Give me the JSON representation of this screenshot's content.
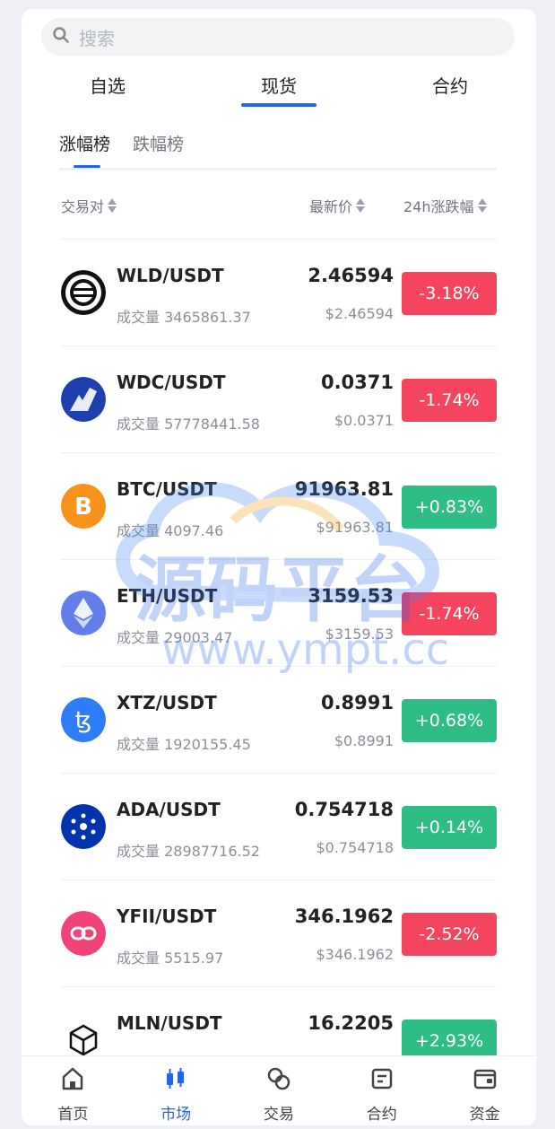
{
  "search": {
    "placeholder": "搜索"
  },
  "tabs": [
    {
      "label": "自选"
    },
    {
      "label": "现货"
    },
    {
      "label": "合约"
    }
  ],
  "subtabs": [
    {
      "label": "涨幅榜"
    },
    {
      "label": "跌幅榜"
    }
  ],
  "columns": {
    "pair": "交易对",
    "price": "最新价",
    "change": "24h涨跌幅"
  },
  "volume_prefix": "成交量",
  "rows": [
    {
      "pair": "WLD/USDT",
      "price": "2.46594",
      "volume": "成交量 3465861.37",
      "usd": "$2.46594",
      "change": "-3.18%",
      "dir": "down",
      "icon": "wld-coin-icon"
    },
    {
      "pair": "WDC/USDT",
      "price": "0.0371",
      "volume": "成交量 57778441.58",
      "usd": "$0.0371",
      "change": "-1.74%",
      "dir": "down",
      "icon": "wdc-coin-icon"
    },
    {
      "pair": "BTC/USDT",
      "price": "91963.81",
      "volume": "成交量 4097.46",
      "usd": "$91963.81",
      "change": "+0.83%",
      "dir": "up",
      "icon": "btc-coin-icon"
    },
    {
      "pair": "ETH/USDT",
      "price": "3159.53",
      "volume": "成交量 29003.47",
      "usd": "$3159.53",
      "change": "-1.74%",
      "dir": "down",
      "icon": "eth-coin-icon"
    },
    {
      "pair": "XTZ/USDT",
      "price": "0.8991",
      "volume": "成交量 1920155.45",
      "usd": "$0.8991",
      "change": "+0.68%",
      "dir": "up",
      "icon": "xtz-coin-icon"
    },
    {
      "pair": "ADA/USDT",
      "price": "0.754718",
      "volume": "成交量 28987716.52",
      "usd": "$0.754718",
      "change": "+0.14%",
      "dir": "up",
      "icon": "ada-coin-icon"
    },
    {
      "pair": "YFII/USDT",
      "price": "346.1962",
      "volume": "成交量 5515.97",
      "usd": "$346.1962",
      "change": "-2.52%",
      "dir": "down",
      "icon": "yfii-coin-icon"
    },
    {
      "pair": "MLN/USDT",
      "price": "16.2205",
      "volume": "",
      "usd": "",
      "change": "+2.93%",
      "dir": "up",
      "icon": "mln-coin-icon"
    }
  ],
  "watermark": {
    "text": "源码平台",
    "url": "www.ympt.cc"
  },
  "nav": [
    {
      "label": "首页",
      "icon": "home-icon"
    },
    {
      "label": "市场",
      "icon": "market-icon",
      "active": true
    },
    {
      "label": "交易",
      "icon": "trade-icon"
    },
    {
      "label": "合约",
      "icon": "contract-icon"
    },
    {
      "label": "资金",
      "icon": "wallet-icon"
    }
  ],
  "colors": {
    "accent": "#2563eb",
    "up": "#2ebd85",
    "down": "#f5445e",
    "active_nav": "#2563eb"
  }
}
